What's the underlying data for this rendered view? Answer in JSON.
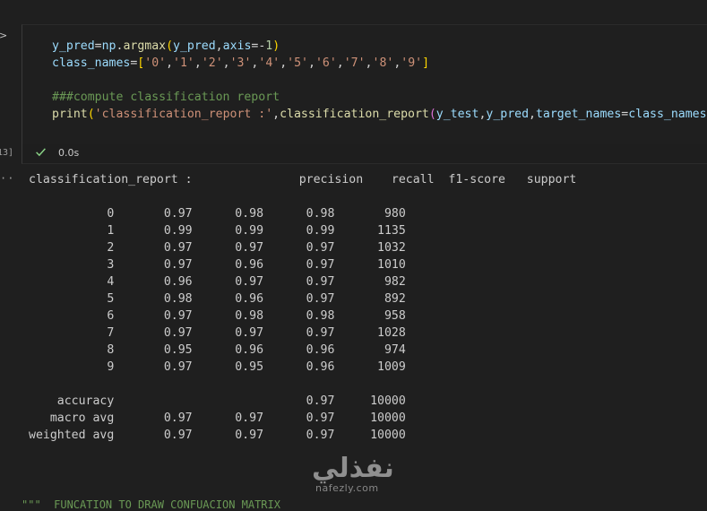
{
  "cell": {
    "execution_count": "13]",
    "code_lines": [
      [
        {
          "t": "y_pred",
          "c": "var"
        },
        {
          "t": "=",
          "c": "op"
        },
        {
          "t": "np",
          "c": "var"
        },
        {
          "t": ".",
          "c": "op"
        },
        {
          "t": "argmax",
          "c": "fn"
        },
        {
          "t": "(",
          "c": "p1"
        },
        {
          "t": "y_pred",
          "c": "var"
        },
        {
          "t": ",",
          "c": "op"
        },
        {
          "t": "axis",
          "c": "var"
        },
        {
          "t": "=-",
          "c": "op"
        },
        {
          "t": "1",
          "c": "num"
        },
        {
          "t": ")",
          "c": "p1"
        }
      ],
      [
        {
          "t": "class_names",
          "c": "var"
        },
        {
          "t": "=",
          "c": "op"
        },
        {
          "t": "[",
          "c": "p1"
        },
        {
          "t": "'0'",
          "c": "str"
        },
        {
          "t": ",",
          "c": "op"
        },
        {
          "t": "'1'",
          "c": "str"
        },
        {
          "t": ",",
          "c": "op"
        },
        {
          "t": "'2'",
          "c": "str"
        },
        {
          "t": ",",
          "c": "op"
        },
        {
          "t": "'3'",
          "c": "str"
        },
        {
          "t": ",",
          "c": "op"
        },
        {
          "t": "'4'",
          "c": "str"
        },
        {
          "t": ",",
          "c": "op"
        },
        {
          "t": "'5'",
          "c": "str"
        },
        {
          "t": ",",
          "c": "op"
        },
        {
          "t": "'6'",
          "c": "str"
        },
        {
          "t": ",",
          "c": "op"
        },
        {
          "t": "'7'",
          "c": "str"
        },
        {
          "t": ",",
          "c": "op"
        },
        {
          "t": "'8'",
          "c": "str"
        },
        {
          "t": ",",
          "c": "op"
        },
        {
          "t": "'9'",
          "c": "str"
        },
        {
          "t": "]",
          "c": "p1"
        }
      ],
      [],
      [
        {
          "t": "###compute classification report",
          "c": "cmt"
        }
      ],
      [
        {
          "t": "print",
          "c": "fn"
        },
        {
          "t": "(",
          "c": "p1"
        },
        {
          "t": "'classification_report :'",
          "c": "str"
        },
        {
          "t": ",",
          "c": "op"
        },
        {
          "t": "classification_report",
          "c": "fn"
        },
        {
          "t": "(",
          "c": "p2"
        },
        {
          "t": "y_test",
          "c": "var"
        },
        {
          "t": ",",
          "c": "op"
        },
        {
          "t": "y_pred",
          "c": "var"
        },
        {
          "t": ",",
          "c": "op"
        },
        {
          "t": "target_names",
          "c": "var"
        },
        {
          "t": "=",
          "c": "op"
        },
        {
          "t": "class_names",
          "c": "var"
        },
        {
          "t": ")",
          "c": "p2"
        },
        {
          "t": ")",
          "c": "p1"
        }
      ]
    ],
    "duration": "0.0s",
    "status_icon": "check-icon"
  },
  "output": {
    "text": "classification_report :               precision    recall  f1-score   support\n\n           0       0.97      0.98      0.98       980\n           1       0.99      0.99      0.99      1135\n           2       0.97      0.97      0.97      1032\n           3       0.97      0.96      0.97      1010\n           4       0.96      0.97      0.97       982\n           5       0.98      0.96      0.97       892\n           6       0.97      0.98      0.98       958\n           7       0.97      0.97      0.97      1028\n           8       0.95      0.96      0.96       974\n           9       0.97      0.95      0.96      1009\n\n    accuracy                           0.97     10000\n   macro avg       0.97      0.97      0.97     10000\nweighted avg       0.97      0.97      0.97     10000"
  },
  "watermark": {
    "arabic": "نفذلي",
    "latin": "nafezly.com"
  },
  "next_cell_comment": "\"\"\"  FUNCATION TO DRAW CONFUACION MATRIX",
  "colors": {
    "background": "#1f1f1f",
    "success": "#89d185"
  }
}
